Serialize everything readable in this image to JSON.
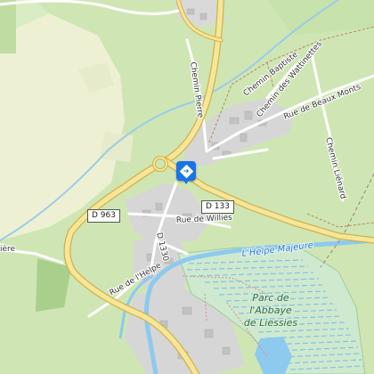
{
  "colors": {
    "background": "#cfe6b4",
    "field": "#eef0d4",
    "urban": "#d6d6d6",
    "major_road": "#f6e69a",
    "major_road_casing": "#d1b14c",
    "minor_road": "#ffffff",
    "water": "#8ec9ee",
    "park": "#cfe9cf",
    "marker": "#1a73e8"
  },
  "map": {
    "road_shields": [
      {
        "id": "d963",
        "label": "D 963"
      },
      {
        "id": "d133",
        "label": "D 133"
      }
    ],
    "street_labels": {
      "chemin_pierre": "Chemin Pierre",
      "chemin_baptiste": "Chemin Baptiste",
      "chemin_wattinettes": "Chemin des Wattinettes",
      "rue_beaux_monts": "Rue de Beaux Monts",
      "chemin_lienard": "Chemin Liénard",
      "rue_willies": "Rue de Willies",
      "d1330": "D 1330",
      "rue_helpe": "Rue de l'Helpe",
      "rue_left": "ière"
    },
    "water_label": "L'Helpe Majeure",
    "park_label_lines": [
      "Parc de",
      "l'Abbaye",
      "de Liessies"
    ],
    "marker_icon": "directions-icon"
  }
}
